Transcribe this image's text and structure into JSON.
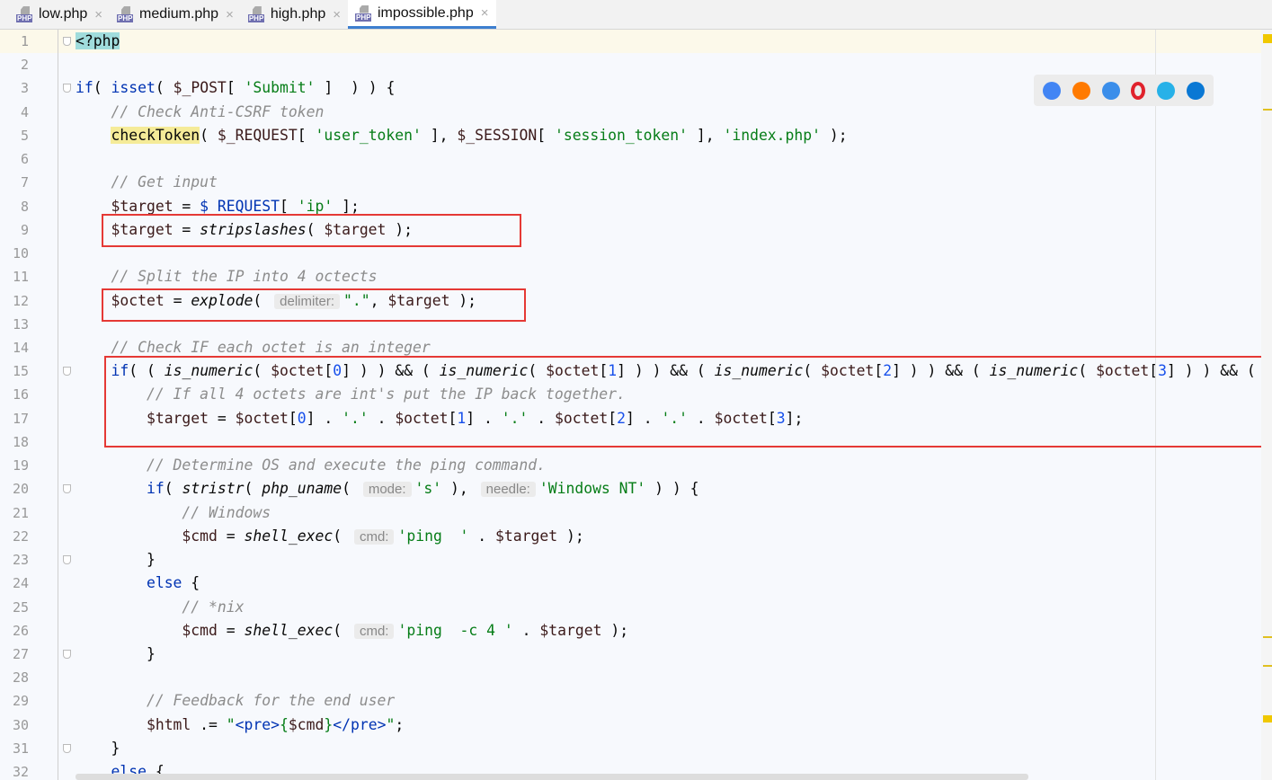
{
  "tabs": [
    {
      "label": "low.php",
      "active": false
    },
    {
      "label": "medium.php",
      "active": false
    },
    {
      "label": "high.php",
      "active": false
    },
    {
      "label": "impossible.php",
      "active": true
    }
  ],
  "file_icon_label": "PHP",
  "browsers": [
    "chrome-icon",
    "firefox-icon",
    "safari-icon",
    "opera-icon",
    "internet-explorer-icon",
    "edge-icon"
  ],
  "browser_colors": [
    "#4285f4",
    "#ff7a00",
    "#3b8eea",
    "#e0222c",
    "#27b1e8",
    "#0a78d4"
  ],
  "lines": [
    [
      [
        "sel",
        "<?php"
      ]
    ],
    [],
    [
      [
        "k",
        "if"
      ],
      [
        "p",
        "( "
      ],
      [
        "k",
        "isset"
      ],
      [
        "p",
        "( "
      ],
      [
        "v",
        "$_POST"
      ],
      [
        "p",
        "[ "
      ],
      [
        "s",
        "'Submit'"
      ],
      [
        "p",
        " ]  ) ) {"
      ]
    ],
    [
      [
        "p",
        "    "
      ],
      [
        "c",
        "// Check Anti-CSRF token"
      ]
    ],
    [
      [
        "p",
        "    "
      ],
      [
        "y",
        "checkToken"
      ],
      [
        "p",
        "( "
      ],
      [
        "v",
        "$_REQUEST"
      ],
      [
        "p",
        "[ "
      ],
      [
        "s",
        "'user_token'"
      ],
      [
        "p",
        " ], "
      ],
      [
        "v",
        "$_SESSION"
      ],
      [
        "p",
        "[ "
      ],
      [
        "s",
        "'session_token'"
      ],
      [
        "p",
        " ], "
      ],
      [
        "s",
        "'index.php'"
      ],
      [
        "p",
        " );"
      ]
    ],
    [],
    [
      [
        "p",
        "    "
      ],
      [
        "c",
        "// Get input"
      ]
    ],
    [
      [
        "p",
        "    "
      ],
      [
        "v",
        "$target"
      ],
      [
        "p",
        " = "
      ],
      [
        "k",
        "$_REQUEST"
      ],
      [
        "p",
        "[ "
      ],
      [
        "s",
        "'ip'"
      ],
      [
        "p",
        " ];"
      ]
    ],
    [
      [
        "p",
        "    "
      ],
      [
        "v",
        "$target"
      ],
      [
        "p",
        " = "
      ],
      [
        "f",
        "stripslashes"
      ],
      [
        "p",
        "( "
      ],
      [
        "v",
        "$target"
      ],
      [
        "p",
        " );"
      ]
    ],
    [],
    [
      [
        "p",
        "    "
      ],
      [
        "c",
        "// Split the IP into 4 octects"
      ]
    ],
    [
      [
        "p",
        "    "
      ],
      [
        "v",
        "$octet"
      ],
      [
        "p",
        " = "
      ],
      [
        "f",
        "explode"
      ],
      [
        "p",
        "( "
      ],
      [
        "h",
        "delimiter:"
      ],
      [
        "s",
        "\".\""
      ],
      [
        "p",
        ", "
      ],
      [
        "v",
        "$target"
      ],
      [
        "p",
        " );"
      ]
    ],
    [],
    [
      [
        "p",
        "    "
      ],
      [
        "c",
        "// Check IF each octet is an integer"
      ]
    ],
    [
      [
        "p",
        "    "
      ],
      [
        "k",
        "if"
      ],
      [
        "p",
        "( ( "
      ],
      [
        "f",
        "is_numeric"
      ],
      [
        "p",
        "( "
      ],
      [
        "v",
        "$octet"
      ],
      [
        "p",
        "["
      ],
      [
        "n",
        "0"
      ],
      [
        "p",
        "] ) ) && ( "
      ],
      [
        "f",
        "is_numeric"
      ],
      [
        "p",
        "( "
      ],
      [
        "v",
        "$octet"
      ],
      [
        "p",
        "["
      ],
      [
        "n",
        "1"
      ],
      [
        "p",
        "] ) ) && ( "
      ],
      [
        "f",
        "is_numeric"
      ],
      [
        "p",
        "( "
      ],
      [
        "v",
        "$octet"
      ],
      [
        "p",
        "["
      ],
      [
        "n",
        "2"
      ],
      [
        "p",
        "] ) ) && ( "
      ],
      [
        "f",
        "is_numeric"
      ],
      [
        "p",
        "( "
      ],
      [
        "v",
        "$octet"
      ],
      [
        "p",
        "["
      ],
      [
        "n",
        "3"
      ],
      [
        "p",
        "] ) ) && ("
      ]
    ],
    [
      [
        "p",
        "        "
      ],
      [
        "c",
        "// If all 4 octets are int's put the IP back together."
      ]
    ],
    [
      [
        "p",
        "        "
      ],
      [
        "v",
        "$target"
      ],
      [
        "p",
        " = "
      ],
      [
        "v",
        "$octet"
      ],
      [
        "p",
        "["
      ],
      [
        "n",
        "0"
      ],
      [
        "p",
        "] . "
      ],
      [
        "s",
        "'.'"
      ],
      [
        "p",
        " . "
      ],
      [
        "v",
        "$octet"
      ],
      [
        "p",
        "["
      ],
      [
        "n",
        "1"
      ],
      [
        "p",
        "] . "
      ],
      [
        "s",
        "'.'"
      ],
      [
        "p",
        " . "
      ],
      [
        "v",
        "$octet"
      ],
      [
        "p",
        "["
      ],
      [
        "n",
        "2"
      ],
      [
        "p",
        "] . "
      ],
      [
        "s",
        "'.'"
      ],
      [
        "p",
        " . "
      ],
      [
        "v",
        "$octet"
      ],
      [
        "p",
        "["
      ],
      [
        "n",
        "3"
      ],
      [
        "p",
        "];"
      ]
    ],
    [],
    [
      [
        "p",
        "        "
      ],
      [
        "c",
        "// Determine OS and execute the ping command."
      ]
    ],
    [
      [
        "p",
        "        "
      ],
      [
        "k",
        "if"
      ],
      [
        "p",
        "( "
      ],
      [
        "f",
        "stristr"
      ],
      [
        "p",
        "( "
      ],
      [
        "f",
        "php_uname"
      ],
      [
        "p",
        "( "
      ],
      [
        "h",
        "mode:"
      ],
      [
        "s",
        "'s'"
      ],
      [
        "p",
        " ), "
      ],
      [
        "h",
        "needle:"
      ],
      [
        "s",
        "'Windows NT'"
      ],
      [
        "p",
        " ) ) {"
      ]
    ],
    [
      [
        "p",
        "            "
      ],
      [
        "c",
        "// Windows"
      ]
    ],
    [
      [
        "p",
        "            "
      ],
      [
        "v",
        "$cmd"
      ],
      [
        "p",
        " = "
      ],
      [
        "f",
        "shell_exec"
      ],
      [
        "p",
        "( "
      ],
      [
        "h",
        "cmd:"
      ],
      [
        "s",
        "'ping  '"
      ],
      [
        "p",
        " . "
      ],
      [
        "v",
        "$target"
      ],
      [
        "p",
        " );"
      ]
    ],
    [
      [
        "p",
        "        }"
      ]
    ],
    [
      [
        "p",
        "        "
      ],
      [
        "k",
        "else"
      ],
      [
        "p",
        " {"
      ]
    ],
    [
      [
        "p",
        "            "
      ],
      [
        "c",
        "// *nix"
      ]
    ],
    [
      [
        "p",
        "            "
      ],
      [
        "v",
        "$cmd"
      ],
      [
        "p",
        " = "
      ],
      [
        "f",
        "shell_exec"
      ],
      [
        "p",
        "( "
      ],
      [
        "h",
        "cmd:"
      ],
      [
        "s",
        "'ping  -c 4 '"
      ],
      [
        "p",
        " . "
      ],
      [
        "v",
        "$target"
      ],
      [
        "p",
        " );"
      ]
    ],
    [
      [
        "p",
        "        }"
      ]
    ],
    [],
    [
      [
        "p",
        "        "
      ],
      [
        "c",
        "// Feedback for the end user"
      ]
    ],
    [
      [
        "p",
        "        "
      ],
      [
        "v",
        "$html"
      ],
      [
        "p",
        " .= "
      ],
      [
        "s",
        "\""
      ],
      [
        "t",
        "<pre>"
      ],
      [
        "s",
        "{"
      ],
      [
        "v",
        "$cmd"
      ],
      [
        "s",
        "}"
      ],
      [
        "t",
        "</pre>"
      ],
      [
        "s",
        "\""
      ],
      [
        "p",
        ";"
      ]
    ],
    [
      [
        "p",
        "    }"
      ]
    ],
    [
      [
        "p",
        "    "
      ],
      [
        "k",
        "else"
      ],
      [
        "p",
        " {"
      ]
    ]
  ]
}
